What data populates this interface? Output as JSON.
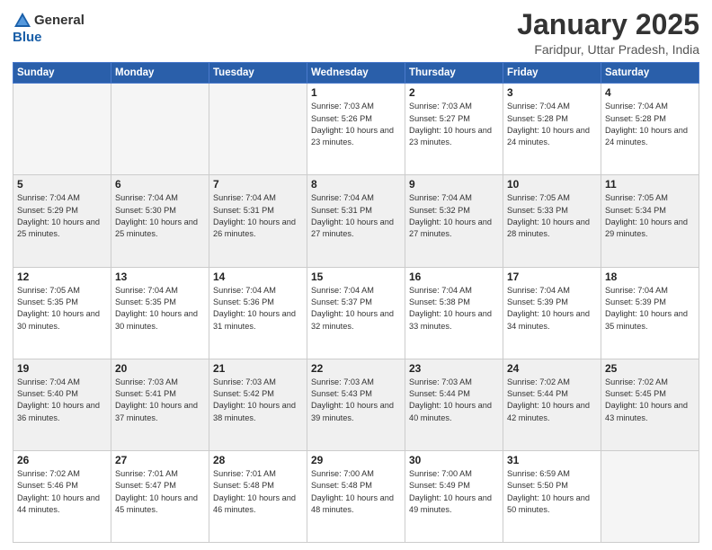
{
  "header": {
    "logo_general": "General",
    "logo_blue": "Blue",
    "title": "January 2025",
    "location": "Faridpur, Uttar Pradesh, India"
  },
  "days_of_week": [
    "Sunday",
    "Monday",
    "Tuesday",
    "Wednesday",
    "Thursday",
    "Friday",
    "Saturday"
  ],
  "weeks": [
    [
      {
        "day": "",
        "empty": true
      },
      {
        "day": "",
        "empty": true
      },
      {
        "day": "",
        "empty": true
      },
      {
        "day": "1",
        "sunrise": "7:03 AM",
        "sunset": "5:26 PM",
        "daylight": "10 hours and 23 minutes."
      },
      {
        "day": "2",
        "sunrise": "7:03 AM",
        "sunset": "5:27 PM",
        "daylight": "10 hours and 23 minutes."
      },
      {
        "day": "3",
        "sunrise": "7:04 AM",
        "sunset": "5:28 PM",
        "daylight": "10 hours and 24 minutes."
      },
      {
        "day": "4",
        "sunrise": "7:04 AM",
        "sunset": "5:28 PM",
        "daylight": "10 hours and 24 minutes."
      }
    ],
    [
      {
        "day": "5",
        "sunrise": "7:04 AM",
        "sunset": "5:29 PM",
        "daylight": "10 hours and 25 minutes."
      },
      {
        "day": "6",
        "sunrise": "7:04 AM",
        "sunset": "5:30 PM",
        "daylight": "10 hours and 25 minutes."
      },
      {
        "day": "7",
        "sunrise": "7:04 AM",
        "sunset": "5:31 PM",
        "daylight": "10 hours and 26 minutes."
      },
      {
        "day": "8",
        "sunrise": "7:04 AM",
        "sunset": "5:31 PM",
        "daylight": "10 hours and 27 minutes."
      },
      {
        "day": "9",
        "sunrise": "7:04 AM",
        "sunset": "5:32 PM",
        "daylight": "10 hours and 27 minutes."
      },
      {
        "day": "10",
        "sunrise": "7:05 AM",
        "sunset": "5:33 PM",
        "daylight": "10 hours and 28 minutes."
      },
      {
        "day": "11",
        "sunrise": "7:05 AM",
        "sunset": "5:34 PM",
        "daylight": "10 hours and 29 minutes."
      }
    ],
    [
      {
        "day": "12",
        "sunrise": "7:05 AM",
        "sunset": "5:35 PM",
        "daylight": "10 hours and 30 minutes."
      },
      {
        "day": "13",
        "sunrise": "7:04 AM",
        "sunset": "5:35 PM",
        "daylight": "10 hours and 30 minutes."
      },
      {
        "day": "14",
        "sunrise": "7:04 AM",
        "sunset": "5:36 PM",
        "daylight": "10 hours and 31 minutes."
      },
      {
        "day": "15",
        "sunrise": "7:04 AM",
        "sunset": "5:37 PM",
        "daylight": "10 hours and 32 minutes."
      },
      {
        "day": "16",
        "sunrise": "7:04 AM",
        "sunset": "5:38 PM",
        "daylight": "10 hours and 33 minutes."
      },
      {
        "day": "17",
        "sunrise": "7:04 AM",
        "sunset": "5:39 PM",
        "daylight": "10 hours and 34 minutes."
      },
      {
        "day": "18",
        "sunrise": "7:04 AM",
        "sunset": "5:39 PM",
        "daylight": "10 hours and 35 minutes."
      }
    ],
    [
      {
        "day": "19",
        "sunrise": "7:04 AM",
        "sunset": "5:40 PM",
        "daylight": "10 hours and 36 minutes."
      },
      {
        "day": "20",
        "sunrise": "7:03 AM",
        "sunset": "5:41 PM",
        "daylight": "10 hours and 37 minutes."
      },
      {
        "day": "21",
        "sunrise": "7:03 AM",
        "sunset": "5:42 PM",
        "daylight": "10 hours and 38 minutes."
      },
      {
        "day": "22",
        "sunrise": "7:03 AM",
        "sunset": "5:43 PM",
        "daylight": "10 hours and 39 minutes."
      },
      {
        "day": "23",
        "sunrise": "7:03 AM",
        "sunset": "5:44 PM",
        "daylight": "10 hours and 40 minutes."
      },
      {
        "day": "24",
        "sunrise": "7:02 AM",
        "sunset": "5:44 PM",
        "daylight": "10 hours and 42 minutes."
      },
      {
        "day": "25",
        "sunrise": "7:02 AM",
        "sunset": "5:45 PM",
        "daylight": "10 hours and 43 minutes."
      }
    ],
    [
      {
        "day": "26",
        "sunrise": "7:02 AM",
        "sunset": "5:46 PM",
        "daylight": "10 hours and 44 minutes."
      },
      {
        "day": "27",
        "sunrise": "7:01 AM",
        "sunset": "5:47 PM",
        "daylight": "10 hours and 45 minutes."
      },
      {
        "day": "28",
        "sunrise": "7:01 AM",
        "sunset": "5:48 PM",
        "daylight": "10 hours and 46 minutes."
      },
      {
        "day": "29",
        "sunrise": "7:00 AM",
        "sunset": "5:48 PM",
        "daylight": "10 hours and 48 minutes."
      },
      {
        "day": "30",
        "sunrise": "7:00 AM",
        "sunset": "5:49 PM",
        "daylight": "10 hours and 49 minutes."
      },
      {
        "day": "31",
        "sunrise": "6:59 AM",
        "sunset": "5:50 PM",
        "daylight": "10 hours and 50 minutes."
      },
      {
        "day": "",
        "empty": true
      }
    ]
  ],
  "row_shade": [
    false,
    true,
    false,
    true,
    false
  ]
}
